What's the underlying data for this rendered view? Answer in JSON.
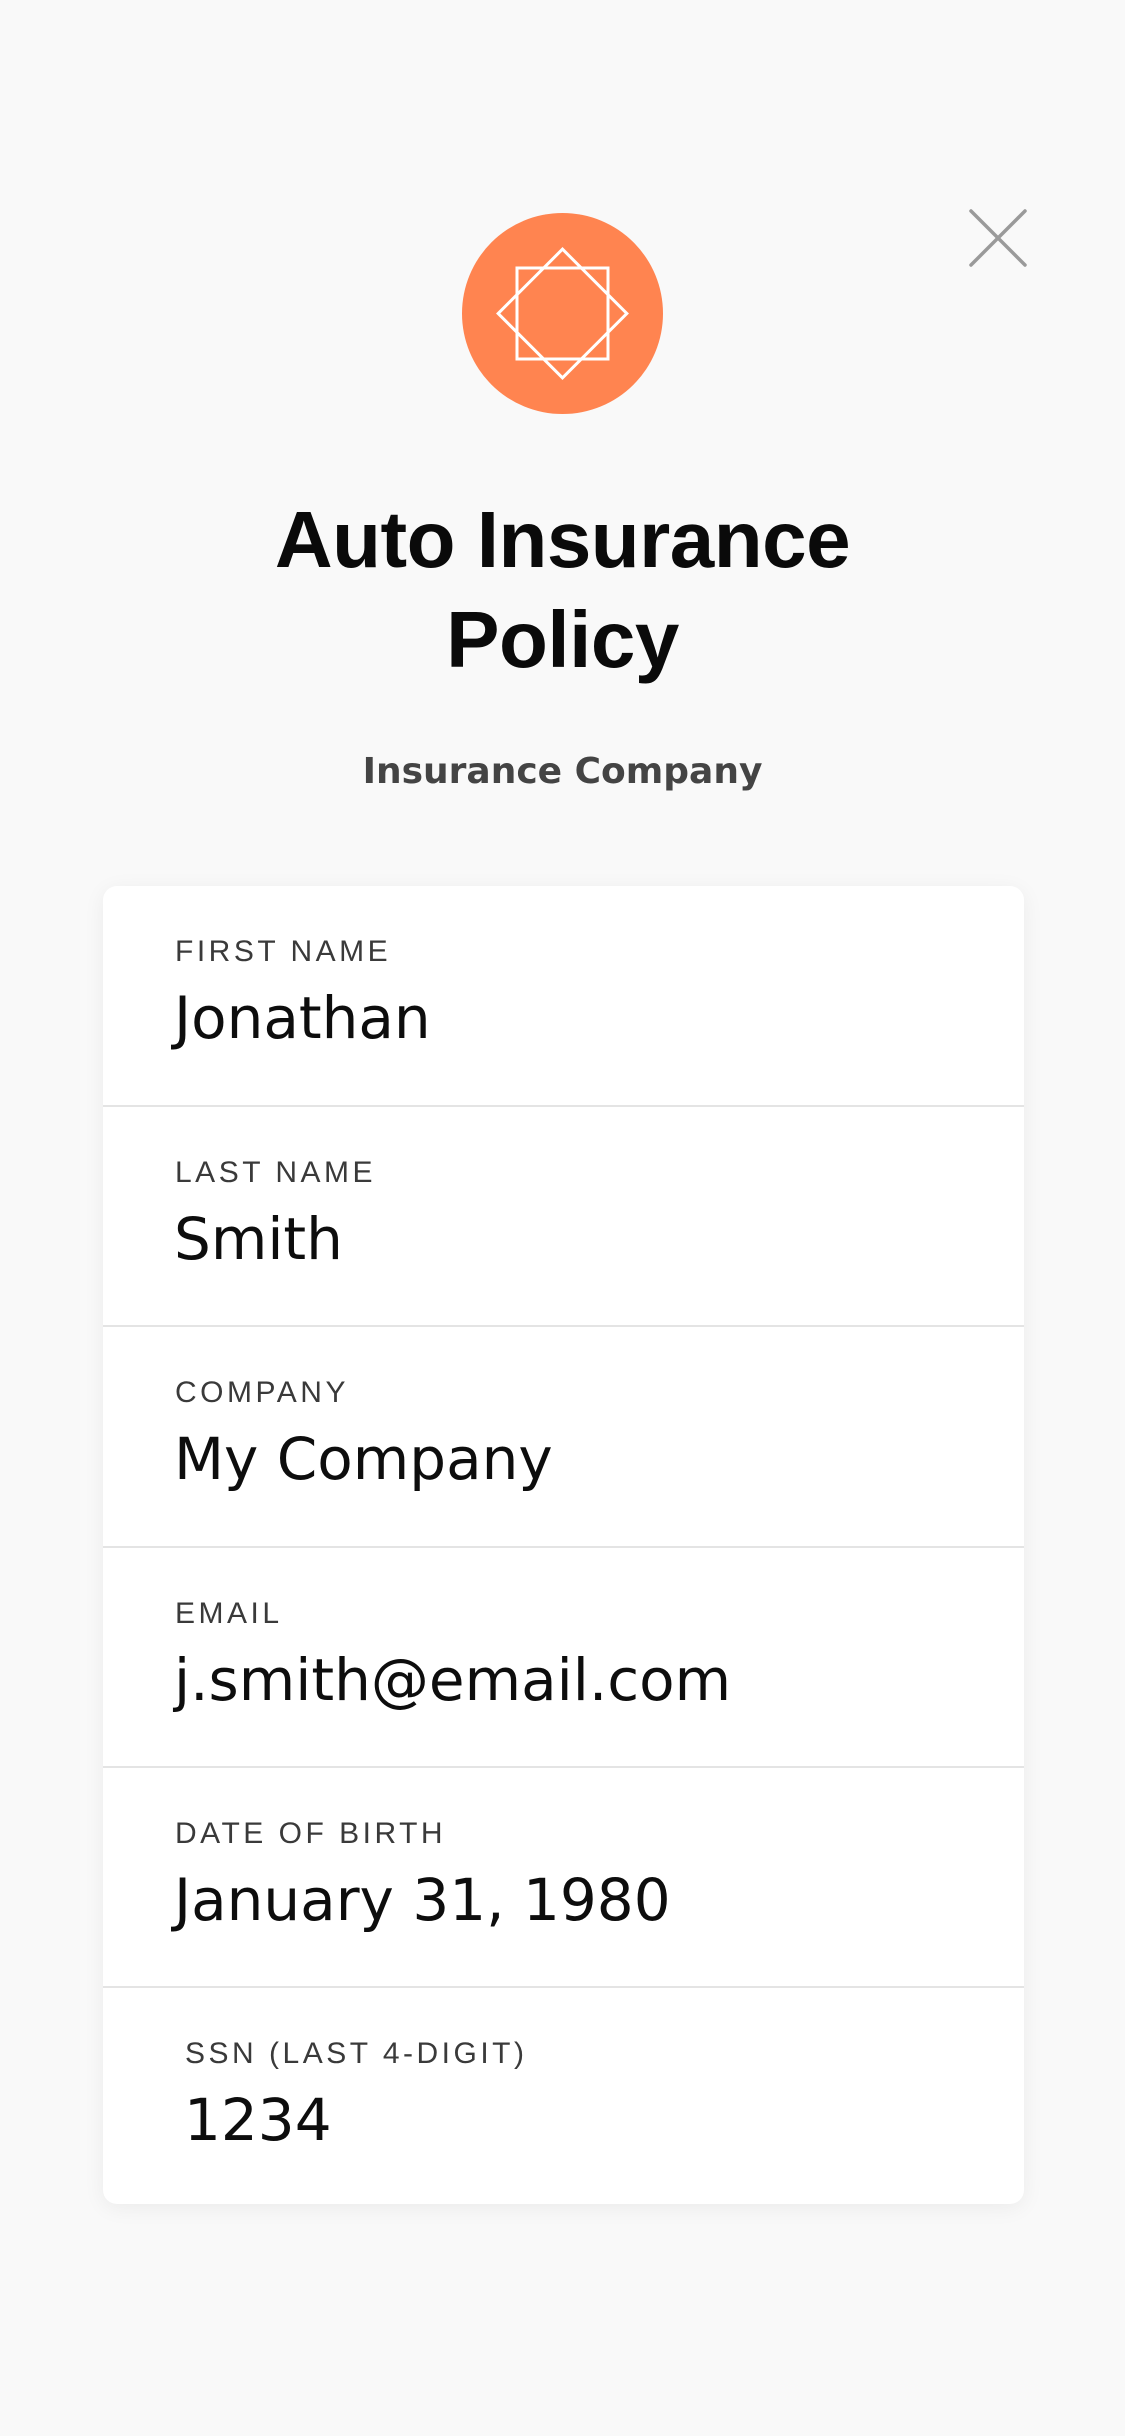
{
  "header": {
    "close_icon": "close-icon",
    "logo_icon": "rotated-squares-star-icon",
    "brand_color": "#ff8450"
  },
  "policy": {
    "title_line1": "Auto Insurance",
    "title_line2": "Policy",
    "company": "Insurance Company"
  },
  "fields": [
    {
      "label": "FIRST NAME",
      "value": "Jonathan"
    },
    {
      "label": "LAST NAME",
      "value": "Smith"
    },
    {
      "label": "COMPANY",
      "value": "My Company"
    },
    {
      "label": "EMAIL",
      "value": "j.smith@email.com"
    },
    {
      "label": "DATE OF BIRTH",
      "value": "January 31, 1980"
    },
    {
      "label": "SSN (LAST 4-DIGIT)",
      "value": "1234"
    }
  ]
}
